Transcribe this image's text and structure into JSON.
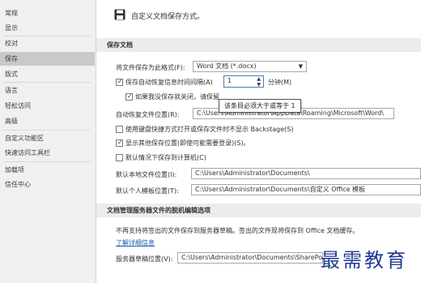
{
  "sidebar": {
    "items": [
      {
        "label": "常规"
      },
      {
        "label": "显示"
      },
      {
        "label": "校对"
      },
      {
        "label": "保存",
        "active": true
      },
      {
        "label": "版式"
      },
      {
        "label": "语言"
      },
      {
        "label": "轻松访问"
      },
      {
        "label": "高级"
      },
      {
        "label": "自定义功能区"
      },
      {
        "label": "快速访问工具栏"
      },
      {
        "label": "加载项"
      },
      {
        "label": "信任中心"
      }
    ]
  },
  "header": {
    "title": "自定义文档保存方式。"
  },
  "save_section": {
    "title": "保存文档",
    "format_label": "将文件保存为此格式(F):",
    "format_value": "Word 文档 (*.docx)",
    "autorecover_label": "保存自动恢复信息时间间隔(A)",
    "autorecover_value": "1",
    "minutes_label": "分钟(M)",
    "keep_last_label": "如果我没保存就关闭，请保留",
    "tooltip": "该条目必须大于或等于 1",
    "autorecover_loc_label": "自动恢复文件位置(R):",
    "autorecover_loc_value": "C:\\Users\\Administrator\\AppData\\Roaming\\Microsoft\\Word\\",
    "backstage_label": "使用键盘快捷方式打开或保存文件时不显示 Backstage(S)",
    "show_more_label": "显示其他保存位置(即使可能需要登录)(S)。",
    "save_to_computer_label": "默认情况下保存到计算机(C)",
    "local_loc_label": "默认本地文件位置(I):",
    "local_loc_value": "C:\\Users\\Administrator\\Documents\\",
    "template_loc_label": "默认个人模板位置(T):",
    "template_loc_value": "C:\\Users\\Administrator\\Documents\\自定义 Office 模板",
    "browse_label": "浏览(B)..."
  },
  "offline_section": {
    "title": "文档管理服务器文件的脱机编辑选项",
    "desc": "不再支持将签出的文件保存到服务器草稿。签出的文件现将保存到 Office 文档缓存。",
    "learn_more": "了解详细信息",
    "drafts_label": "服务器草稿位置(V):",
    "drafts_value": "C:\\Users\\Administrator\\Documents\\SharePoint 草稿\\"
  },
  "watermark": "最需教育"
}
